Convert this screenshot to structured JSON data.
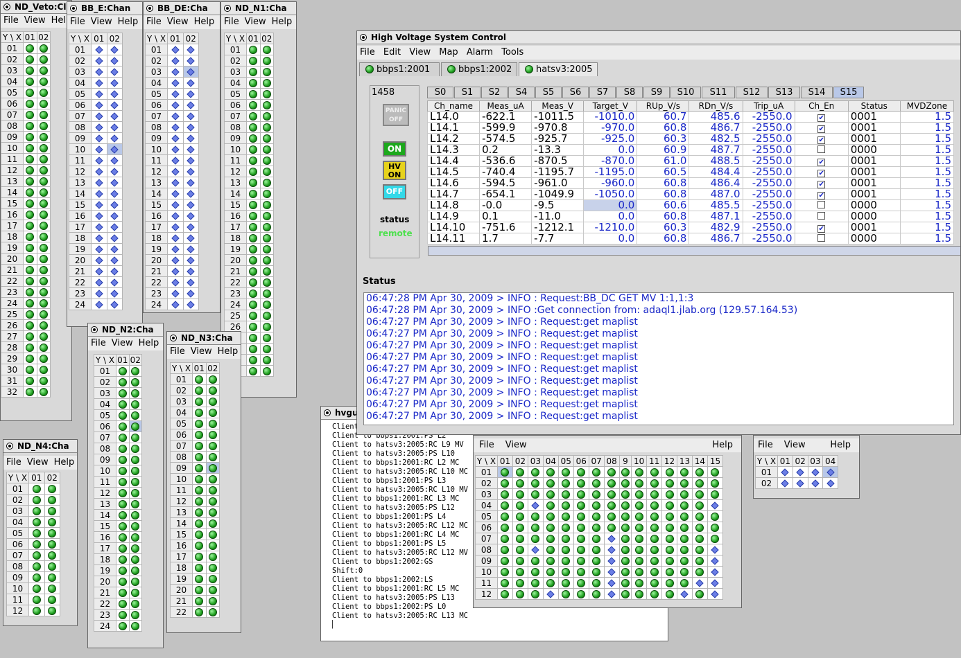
{
  "win_veto": {
    "title": "ND_Veto:Cl",
    "menu": [
      "File",
      "View",
      "Help"
    ],
    "cols": [
      "Y \\ X",
      "01",
      "02"
    ],
    "rows": [
      "01",
      "02",
      "03",
      "04",
      "05",
      "06",
      "07",
      "08",
      "09",
      "10",
      "11",
      "12",
      "13",
      "14",
      "15",
      "16",
      "17",
      "18",
      "19",
      "20",
      "21",
      "22",
      "23",
      "24",
      "25",
      "26",
      "27",
      "28",
      "29",
      "30",
      "31",
      "32"
    ]
  },
  "win_bbe": {
    "title": "BB_E:Chan",
    "menu": [
      "File",
      "View",
      "Help"
    ],
    "cols": [
      "Y \\ X",
      "01",
      "02"
    ],
    "rows": [
      "01",
      "02",
      "03",
      "04",
      "05",
      "06",
      "07",
      "08",
      "09",
      "10",
      "11",
      "12",
      "13",
      "14",
      "15",
      "16",
      "17",
      "18",
      "19",
      "20",
      "21",
      "22",
      "23",
      "24"
    ]
  },
  "win_bbde": {
    "title": "BB_DE:Cha",
    "menu": [
      "File",
      "View",
      "Help"
    ],
    "cols": [
      "Y \\ X",
      "01",
      "02"
    ],
    "rows": [
      "01",
      "02",
      "03",
      "04",
      "05",
      "06",
      "07",
      "08",
      "09",
      "10",
      "11",
      "12",
      "13",
      "14",
      "15",
      "16",
      "17",
      "18",
      "19",
      "20",
      "21",
      "22",
      "23",
      "24"
    ]
  },
  "win_n1": {
    "title": "ND_N1:Cha",
    "menu": [
      "File",
      "View",
      "Help"
    ],
    "cols": [
      "Y \\ X",
      "01",
      "02"
    ],
    "rows": [
      "01",
      "02",
      "03",
      "04",
      "05",
      "06",
      "07",
      "08",
      "09",
      "10",
      "11",
      "12",
      "13",
      "14",
      "15",
      "16",
      "17",
      "18",
      "19",
      "20",
      "21",
      "22",
      "23",
      "24",
      "25",
      "26",
      "27",
      "28",
      "29",
      "30"
    ]
  },
  "win_n2": {
    "title": "ND_N2:Cha",
    "menu": [
      "File",
      "View",
      "Help"
    ],
    "cols": [
      "Y \\ X",
      "01",
      "02"
    ],
    "rows": [
      "01",
      "02",
      "03",
      "04",
      "05",
      "06",
      "07",
      "08",
      "09",
      "10",
      "11",
      "12",
      "13",
      "14",
      "15",
      "16",
      "17",
      "18",
      "19",
      "20",
      "21",
      "22",
      "23",
      "24"
    ]
  },
  "win_n3": {
    "title": "ND_N3:Cha",
    "menu": [
      "File",
      "View",
      "Help"
    ],
    "cols": [
      "Y \\ X",
      "01",
      "02"
    ],
    "rows": [
      "01",
      "02",
      "03",
      "04",
      "05",
      "06",
      "07",
      "08",
      "09",
      "10",
      "11",
      "12",
      "13",
      "14",
      "15",
      "16",
      "17",
      "18",
      "19",
      "20",
      "21",
      "22"
    ]
  },
  "win_n4": {
    "title": "ND_N4:Cha",
    "menu": [
      "File",
      "View",
      "Help"
    ],
    "cols": [
      "Y \\ X",
      "01",
      "02"
    ],
    "rows": [
      "01",
      "02",
      "03",
      "04",
      "05",
      "06",
      "07",
      "08",
      "09",
      "10",
      "11",
      "12"
    ]
  },
  "main": {
    "title": "High Voltage System Control",
    "menu": [
      "File",
      "Edit",
      "View",
      "Map",
      "Alarm",
      "Tools"
    ],
    "pages": [
      "bbps1:2001",
      "bbps1:2002",
      "hatsv3:2005"
    ],
    "crate_id": "1458",
    "panic_label": "PANIC OFF",
    "on_label": "ON",
    "hv_on_label": "HV ON",
    "off_label": "OFF",
    "status_label": "status",
    "status_value": "remote",
    "slots": [
      "S0",
      "S1",
      "S2",
      "S4",
      "S5",
      "S6",
      "S7",
      "S8",
      "S9",
      "S10",
      "S11",
      "S12",
      "S13",
      "S14",
      "S15"
    ],
    "columns": [
      "Ch_name",
      "Meas_uA",
      "Meas_V",
      "Target_V",
      "RUp_V/s",
      "RDn_V/s",
      "Trip_uA",
      "Ch_En",
      "Status",
      "MVDZone"
    ],
    "rows": [
      [
        "L14.0",
        "-622.1",
        "-1011.5",
        "-1010.0",
        "60.7",
        "485.6",
        "-2550.0",
        true,
        "0001",
        "1.5"
      ],
      [
        "L14.1",
        "-599.9",
        "-970.8",
        "-970.0",
        "60.8",
        "486.7",
        "-2550.0",
        true,
        "0001",
        "1.5"
      ],
      [
        "L14.2",
        "-574.5",
        "-925.7",
        "-925.0",
        "60.3",
        "482.5",
        "-2550.0",
        true,
        "0001",
        "1.5"
      ],
      [
        "L14.3",
        "0.2",
        "-13.3",
        "0.0",
        "60.9",
        "487.7",
        "-2550.0",
        false,
        "0000",
        "1.5"
      ],
      [
        "L14.4",
        "-536.6",
        "-870.5",
        "-870.0",
        "61.0",
        "488.5",
        "-2550.0",
        true,
        "0001",
        "1.5"
      ],
      [
        "L14.5",
        "-740.4",
        "-1195.7",
        "-1195.0",
        "60.5",
        "484.4",
        "-2550.0",
        true,
        "0001",
        "1.5"
      ],
      [
        "L14.6",
        "-594.5",
        "-961.0",
        "-960.0",
        "60.8",
        "486.4",
        "-2550.0",
        true,
        "0001",
        "1.5"
      ],
      [
        "L14.7",
        "-654.1",
        "-1049.9",
        "-1050.0",
        "60.8",
        "487.0",
        "-2550.0",
        true,
        "0001",
        "1.5"
      ],
      [
        "L14.8",
        "-0.0",
        "-9.5",
        "0.0",
        "60.6",
        "485.5",
        "-2550.0",
        false,
        "0000",
        "1.5"
      ],
      [
        "L14.9",
        "0.1",
        "-11.0",
        "0.0",
        "60.8",
        "487.1",
        "-2550.0",
        false,
        "0000",
        "1.5"
      ],
      [
        "L14.10",
        "-751.6",
        "-1212.1",
        "-1210.0",
        "60.3",
        "482.9",
        "-2550.0",
        true,
        "0001",
        "1.5"
      ],
      [
        "L14.11",
        "1.7",
        "-7.7",
        "0.0",
        "60.8",
        "486.7",
        "-2550.0",
        false,
        "0000",
        "1.5"
      ]
    ],
    "status_title": "Status",
    "log": [
      "06:47:28 PM Apr 30, 2009 > INFO : Request:BB_DC GET MV 1:1,1:3",
      "06:47:28 PM Apr 30, 2009 > INFO :Get connection from: adaql1.jlab.org (129.57.164.53)",
      "06:47:27 PM Apr 30, 2009 > INFO : Request:get maplist",
      "06:47:27 PM Apr 30, 2009 > INFO : Request:get maplist",
      "06:47:27 PM Apr 30, 2009 > INFO : Request:get maplist",
      "06:47:27 PM Apr 30, 2009 > INFO : Request:get maplist",
      "06:47:27 PM Apr 30, 2009 > INFO : Request:get maplist",
      "06:47:27 PM Apr 30, 2009 > INFO : Request:get maplist",
      "06:47:27 PM Apr 30, 2009 > INFO : Request:get maplist",
      "06:47:27 PM Apr 30, 2009 > INFO : Request:get maplist",
      "06:47:27 PM Apr 30, 2009 > INFO : Request:get maplist"
    ]
  },
  "terminal": {
    "title": "hvgu",
    "lines": [
      "Client to hatsv3:2005:RC L9 MC",
      "Client to bbps1:2001:PS L2",
      "Client to hatsv3:2005:RC L9 MV",
      "Client to hatsv3:2005:PS L10",
      "Client to bbps1:2001:RC L2 MC",
      "Client to hatsv3:2005:RC L10 MC",
      "Client to bbps1:2001:PS L3",
      "Client to hatsv3:2005:RC L10 MV",
      "Client to bbps1:2001:RC L3 MC",
      "Client to hatsv3:2005:PS L12",
      "Client to bbps1:2001:PS L4",
      "Client to hatsv3:2005:RC L12 MC",
      "Client to bbps1:2001:RC L4 MC",
      "Client to bbps1:2001:PS L5",
      "Client to hatsv3:2005:RC L12 MV",
      "Client to bbps1:2002:GS",
      "Shift:0",
      "Client to bbps1:2002:LS",
      "Client to bbps1:2001:RC L5 MC",
      "Client to hatsv3:2005:PS L13",
      "Client to bbps1:2002:PS L0",
      "Client to hatsv3:2005:RC L13 MC"
    ]
  },
  "grid_big": {
    "menu": [
      "File",
      "View",
      "Help"
    ],
    "cols": [
      "Y \\ X",
      "01",
      "02",
      "03",
      "04",
      "05",
      "06",
      "07",
      "08",
      "9",
      "10",
      "11",
      "12",
      "13",
      "14",
      "15"
    ],
    "rows": [
      "01",
      "02",
      "03",
      "04",
      "05",
      "06",
      "07",
      "08",
      "09",
      "10",
      "11",
      "12"
    ]
  },
  "grid_small": {
    "menu": [
      "File",
      "View",
      "Help"
    ],
    "cols": [
      "Y \\ X",
      "01",
      "02",
      "03",
      "04"
    ],
    "rows": [
      "01",
      "02"
    ]
  }
}
